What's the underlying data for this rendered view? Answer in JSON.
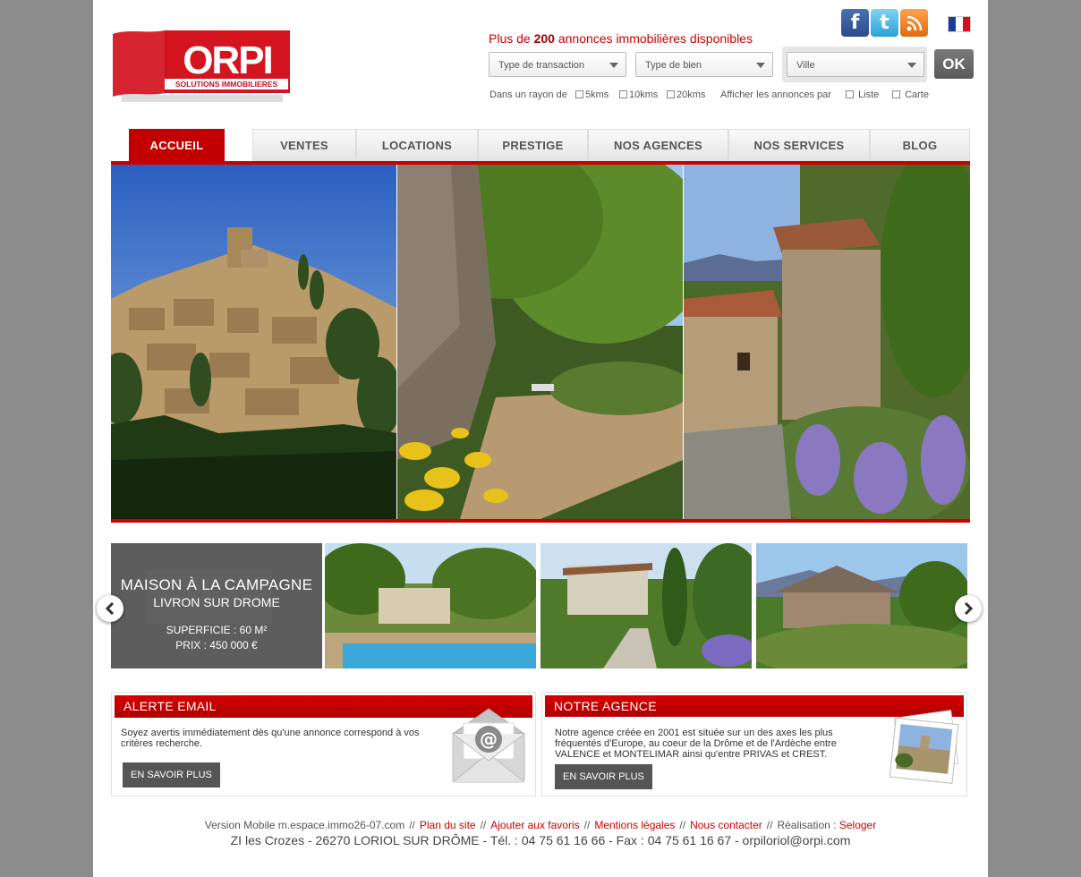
{
  "header": {
    "logo_text": "ORPI",
    "logo_subtitle": "SOLUTIONS IMMOBILIERES",
    "count_prefix": "Plus de",
    "count_value": "200",
    "count_suffix": "annonces immobilières disponibles"
  },
  "social": {
    "facebook_icon": "facebook-icon",
    "twitter_icon": "twitter-icon",
    "rss_icon": "rss-icon",
    "language": "fr-flag-icon"
  },
  "search": {
    "transaction_value": "Type de transaction",
    "bien_value": "Type de bien",
    "ville_value": "Ville",
    "ok_label": "OK",
    "radius_label": "Dans un rayon de",
    "radius_options": [
      "5kms",
      "10kms",
      "20kms"
    ],
    "display_label": "Afficher les annonces par",
    "display_options": [
      "Liste",
      "Carte"
    ]
  },
  "nav": {
    "items": [
      "ACCUEIL",
      "VENTES",
      "LOCATIONS",
      "PRESTIGE",
      "NOS AGENCES",
      "NOS SERVICES",
      "BLOG"
    ],
    "active": "ACCUEIL"
  },
  "carousel": {
    "title": "MAISON À LA CAMPAGNE",
    "location": "LIVRON SUR DROME",
    "surface": "SUPERFICIE : 60 M²",
    "price": "PRIX : 450 000 €"
  },
  "alert_box": {
    "title": "ALERTE EMAIL",
    "text": "Soyez avertis immédiatement dès qu'une annonce correspond à vos critères recherche.",
    "button": "EN SAVOIR PLUS",
    "icon": "email-envelope-icon"
  },
  "agency_box": {
    "title": "NOTRE AGENCE",
    "text": "Notre agence créée en 2001 est située sur un des axes les plus fréquentés d'Europe, au coeur de la Drôme et de l'Ardèche entre VALENCE et MONTELIMAR ainsi qu'entre PRIVAS et CREST.",
    "button": "EN SAVOIR PLUS",
    "icon": "photo-polaroid-icon"
  },
  "footer": {
    "mobile": "Version Mobile m.espace.immo26-07.com",
    "links": [
      "Plan du site",
      "Ajouter aux favoris",
      "Mentions légales",
      "Nous contacter"
    ],
    "realisation_label": "Réalisation :",
    "realisation_link": "Seloger",
    "address": "ZI les Crozes - 26270 LORIOL SUR DRÔME - Tél. : 04 75 61 16 66 - Fax : 04 75 61 16 67 - orpiloriol@orpi.com"
  },
  "colors": {
    "brand_red": "#c20000",
    "nav_bar": "#cc0000",
    "footer_link": "#cc0000"
  }
}
